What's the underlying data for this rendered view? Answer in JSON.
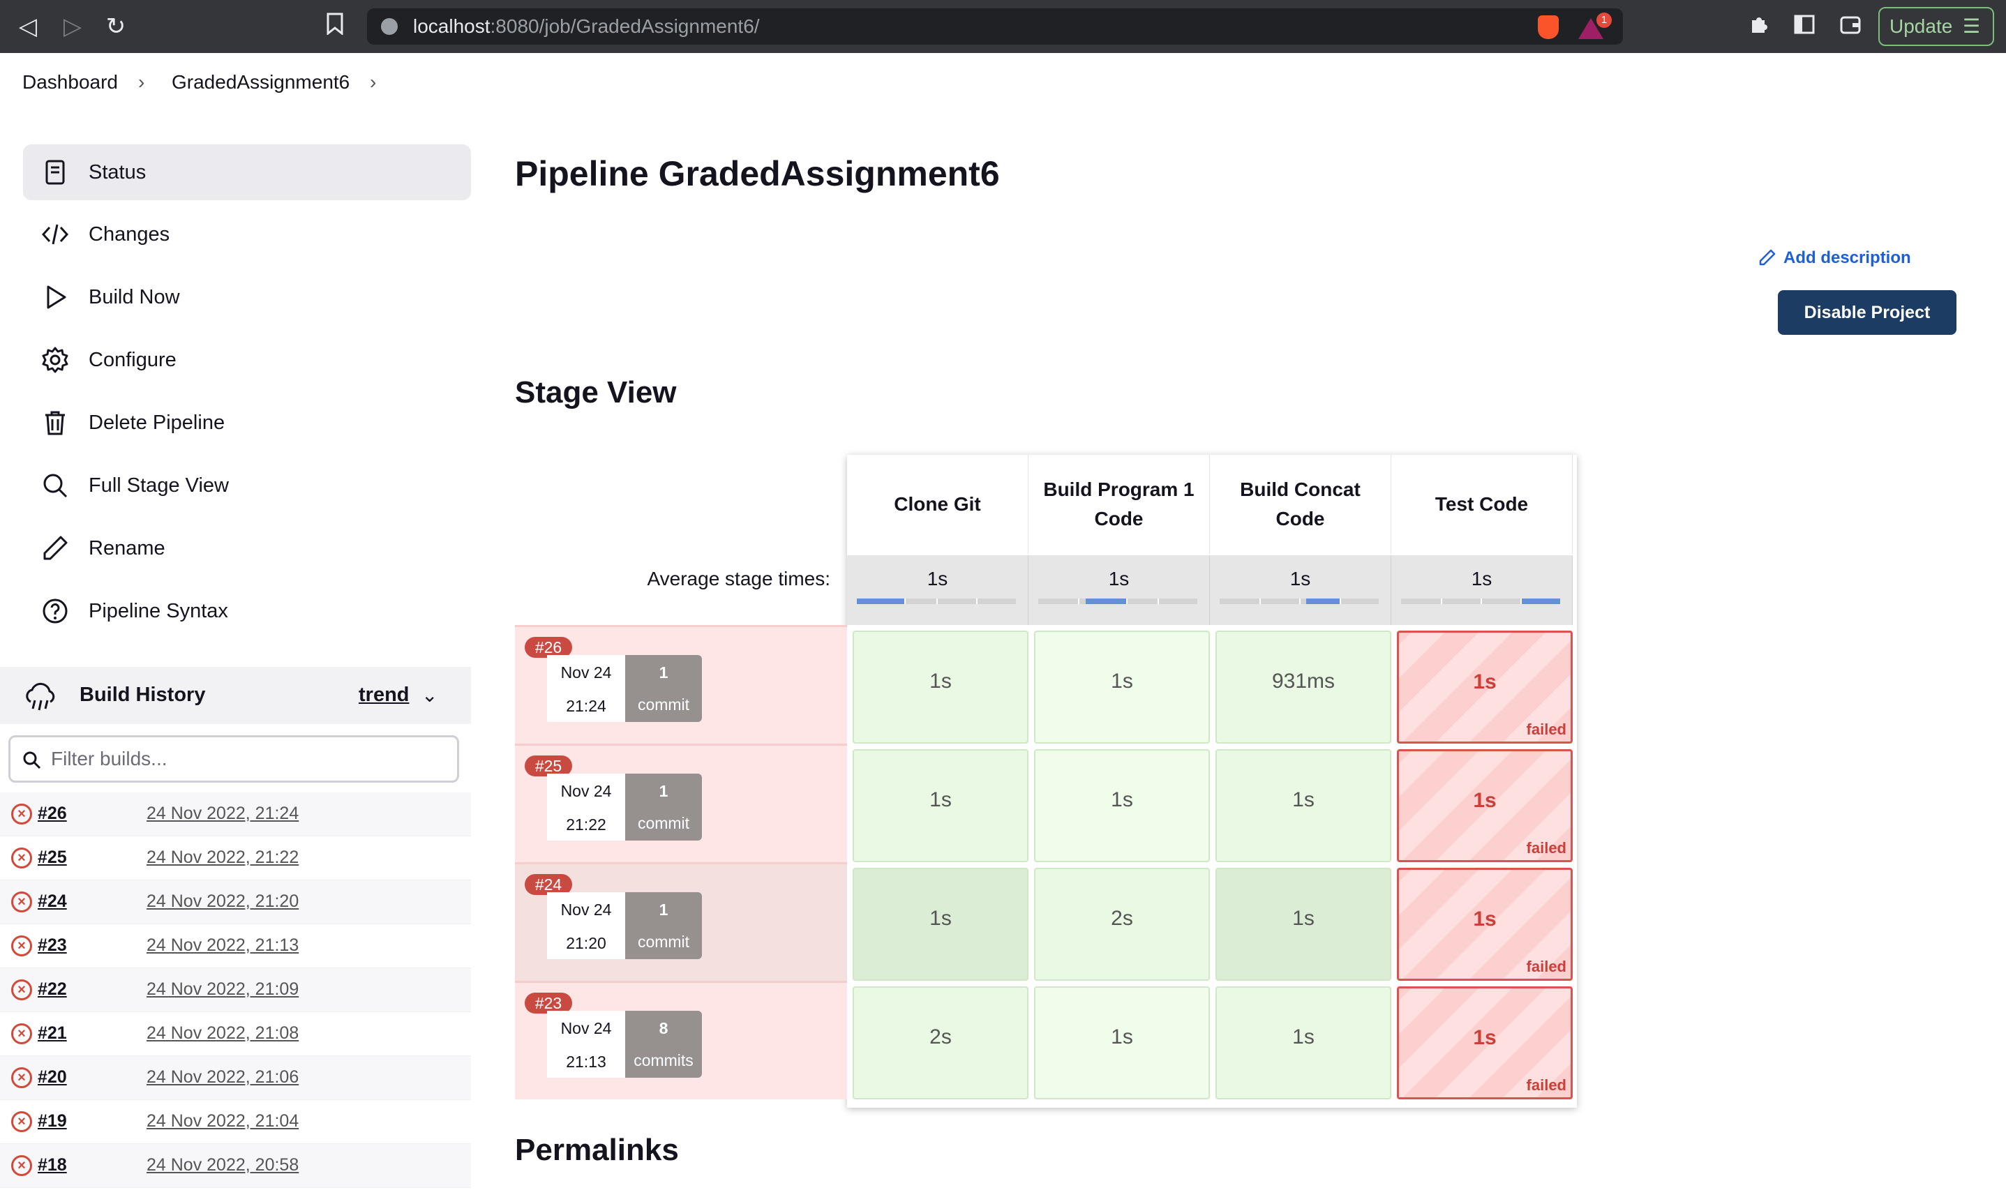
{
  "browser": {
    "url_host": "localhost",
    "url_rest": ":8080/job/GradedAssignment6/",
    "update_label": "Update",
    "rewards_count": "1"
  },
  "breadcrumb": {
    "items": [
      "Dashboard",
      "GradedAssignment6"
    ]
  },
  "sidebar": {
    "tasks": [
      {
        "label": "Status",
        "icon": "status-icon"
      },
      {
        "label": "Changes",
        "icon": "code-icon"
      },
      {
        "label": "Build Now",
        "icon": "play-icon"
      },
      {
        "label": "Configure",
        "icon": "gear-icon"
      },
      {
        "label": "Delete Pipeline",
        "icon": "trash-icon"
      },
      {
        "label": "Full Stage View",
        "icon": "search-icon"
      },
      {
        "label": "Rename",
        "icon": "pencil-icon"
      },
      {
        "label": "Pipeline Syntax",
        "icon": "help-icon"
      }
    ]
  },
  "build_history": {
    "title": "Build History",
    "trend": "trend",
    "filter_placeholder": "Filter builds...",
    "builds": [
      {
        "num": "#26",
        "date": "24 Nov 2022, 21:24"
      },
      {
        "num": "#25",
        "date": "24 Nov 2022, 21:22"
      },
      {
        "num": "#24",
        "date": "24 Nov 2022, 21:20"
      },
      {
        "num": "#23",
        "date": "24 Nov 2022, 21:13"
      },
      {
        "num": "#22",
        "date": "24 Nov 2022, 21:09"
      },
      {
        "num": "#21",
        "date": "24 Nov 2022, 21:08"
      },
      {
        "num": "#20",
        "date": "24 Nov 2022, 21:06"
      },
      {
        "num": "#19",
        "date": "24 Nov 2022, 21:04"
      },
      {
        "num": "#18",
        "date": "24 Nov 2022, 20:58"
      }
    ]
  },
  "main": {
    "title": "Pipeline GradedAssignment6",
    "add_description": "Add description",
    "disable_project": "Disable Project",
    "stage_view_title": "Stage View",
    "permalinks_title": "Permalinks",
    "avg_label": "Average stage times:"
  },
  "stages": {
    "headers": [
      "Clone Git",
      "Build Program 1 Code",
      "Build Concat Code",
      "Test Code"
    ],
    "avg_times": [
      "1s",
      "1s",
      "1s",
      "1s"
    ],
    "avg_progress_fraction": [
      0.3,
      0.3,
      0.3,
      0.3
    ],
    "runs": [
      {
        "badge": "#26",
        "date": "Nov 24",
        "time": "21:24",
        "commits": "1",
        "commits_label": "commit",
        "cells": [
          "1s",
          "1s",
          "931ms",
          "1s"
        ],
        "failed_label": "failed"
      },
      {
        "badge": "#25",
        "date": "Nov 24",
        "time": "21:22",
        "commits": "1",
        "commits_label": "commit",
        "cells": [
          "1s",
          "1s",
          "1s",
          "1s"
        ],
        "failed_label": "failed"
      },
      {
        "badge": "#24",
        "date": "Nov 24",
        "time": "21:20",
        "commits": "1",
        "commits_label": "commit",
        "cells": [
          "1s",
          "2s",
          "1s",
          "1s"
        ],
        "failed_label": "failed"
      },
      {
        "badge": "#23",
        "date": "Nov 24",
        "time": "21:13",
        "commits": "8",
        "commits_label": "commits",
        "cells": [
          "2s",
          "1s",
          "1s",
          "1s"
        ],
        "failed_label": "failed"
      }
    ]
  },
  "colors": {
    "accent": "#1c3c63",
    "link": "#1d5fd6",
    "success": "#e9f9e3",
    "failure": "#d9534f"
  }
}
